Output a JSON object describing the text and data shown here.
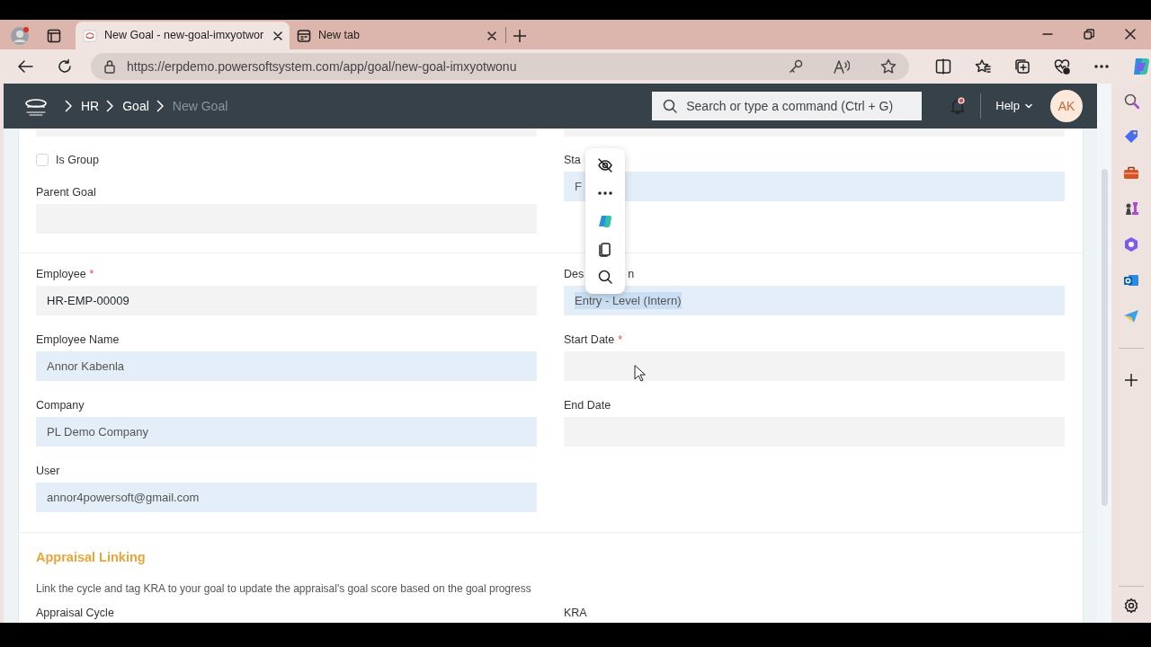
{
  "browser": {
    "tabs": [
      {
        "title": "New Goal - new-goal-imxyotwor",
        "selected": true
      },
      {
        "title": "New tab",
        "selected": false
      }
    ],
    "url": "https://erpdemo.powersoftsystem.com/app/goal/new-goal-imxyotwonu"
  },
  "app": {
    "breadcrumbs": [
      {
        "label": "HR",
        "current": false
      },
      {
        "label": "Goal",
        "current": false
      },
      {
        "label": "New Goal",
        "current": true
      }
    ],
    "search": {
      "placeholder": "Search or type a command (Ctrl + G)"
    },
    "help": "Help",
    "avatar": "AK"
  },
  "form": {
    "sections": [
      {
        "partial_top": true,
        "left": [
          {
            "kind": "checkbox",
            "label": "Is Group",
            "checked": false
          },
          {
            "kind": "input",
            "label": "Parent Goal",
            "readonly": false
          }
        ],
        "right": [
          {
            "kind": "input",
            "label": "Sta",
            "value": "F",
            "readonly": true
          }
        ]
      },
      {
        "left": [
          {
            "kind": "input",
            "label": "Employee",
            "required_mark": "*",
            "value": "HR-EMP-00009",
            "readonly": false
          },
          {
            "kind": "input",
            "label": "Employee Name",
            "value": "Annor Kabenla",
            "readonly": true
          },
          {
            "kind": "input",
            "label": "Company",
            "value": "PL Demo Company",
            "readonly": true
          },
          {
            "kind": "input",
            "label": "User",
            "value": "annor4powersoft@gmail.com",
            "readonly": true
          }
        ],
        "right": [
          {
            "kind": "input",
            "label": "Des",
            "label_tail": "n",
            "value": "Entry - Level (Intern)",
            "readonly": true,
            "highlighted": true
          },
          {
            "kind": "input",
            "label": "Start Date",
            "required_mark": "*",
            "readonly": false
          },
          {
            "kind": "input",
            "label": "End Date",
            "readonly": false
          }
        ]
      },
      {
        "title": "Appraisal Linking",
        "description": "Link the cycle and tag KRA to your goal to update the appraisal's goal score based on the goal progress",
        "left": [
          {
            "kind": "label",
            "label": "Appraisal Cycle"
          }
        ],
        "right": [
          {
            "kind": "label",
            "label": "KRA"
          }
        ]
      }
    ]
  }
}
